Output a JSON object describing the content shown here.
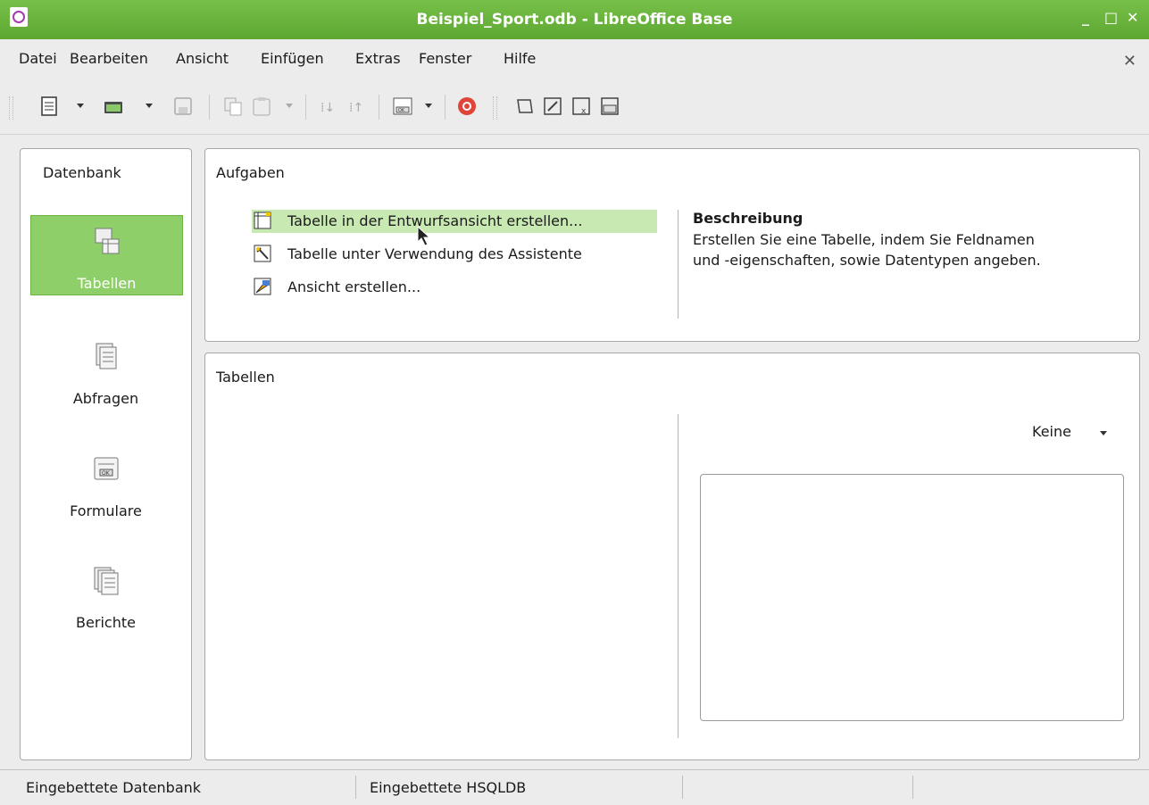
{
  "window": {
    "title": "Beispiel_Sport.odb - LibreOffice Base",
    "controls": [
      "minimize-icon",
      "maximize-icon",
      "close-icon"
    ]
  },
  "menu": {
    "items": [
      "Datei",
      "Bearbeiten",
      "Ansicht",
      "Einfügen",
      "Extras",
      "Fenster",
      "Hilfe"
    ],
    "close_document": "✕"
  },
  "toolbar": {
    "buttons": [
      "new-document-icon",
      "open-icon",
      "save-icon",
      "copy-icon",
      "paste-icon",
      "sort-ascending-icon",
      "sort-descending-icon",
      "form-icon",
      "help-icon",
      "open-db-object-icon",
      "edit-icon",
      "delete-icon",
      "rename-icon"
    ]
  },
  "sidebar": {
    "header": "Datenbank",
    "items": [
      {
        "label": "Tabellen",
        "selected": true,
        "icon": "tables-icon"
      },
      {
        "label": "Abfragen",
        "selected": false,
        "icon": "queries-icon"
      },
      {
        "label": "Formulare",
        "selected": false,
        "icon": "forms-icon"
      },
      {
        "label": "Berichte",
        "selected": false,
        "icon": "reports-icon"
      }
    ]
  },
  "tasks": {
    "header": "Aufgaben",
    "items": [
      {
        "label": "Tabelle in der Entwurfsansicht erstellen...",
        "icon": "table-design-icon",
        "highlighted": true
      },
      {
        "label": "Tabelle unter Verwendung des Assistente",
        "icon": "wizard-icon",
        "highlighted": false
      },
      {
        "label": "Ansicht erstellen...",
        "icon": "view-create-icon",
        "highlighted": false
      }
    ],
    "description_title": "Beschreibung",
    "description": "Erstellen Sie eine Tabelle, indem Sie Feldnamen und -eigenschaften, sowie Datentypen angeben."
  },
  "tables": {
    "header": "Tabellen",
    "preview_mode": "Keine"
  },
  "statusbar": {
    "fields": [
      "Eingebettete Datenbank",
      "Eingebettete HSQLDB",
      "",
      ""
    ]
  },
  "colors": {
    "titlebar": "#6cb83f",
    "selected_category": "#8fcf6a",
    "task_highlight": "#c9e9b3"
  }
}
